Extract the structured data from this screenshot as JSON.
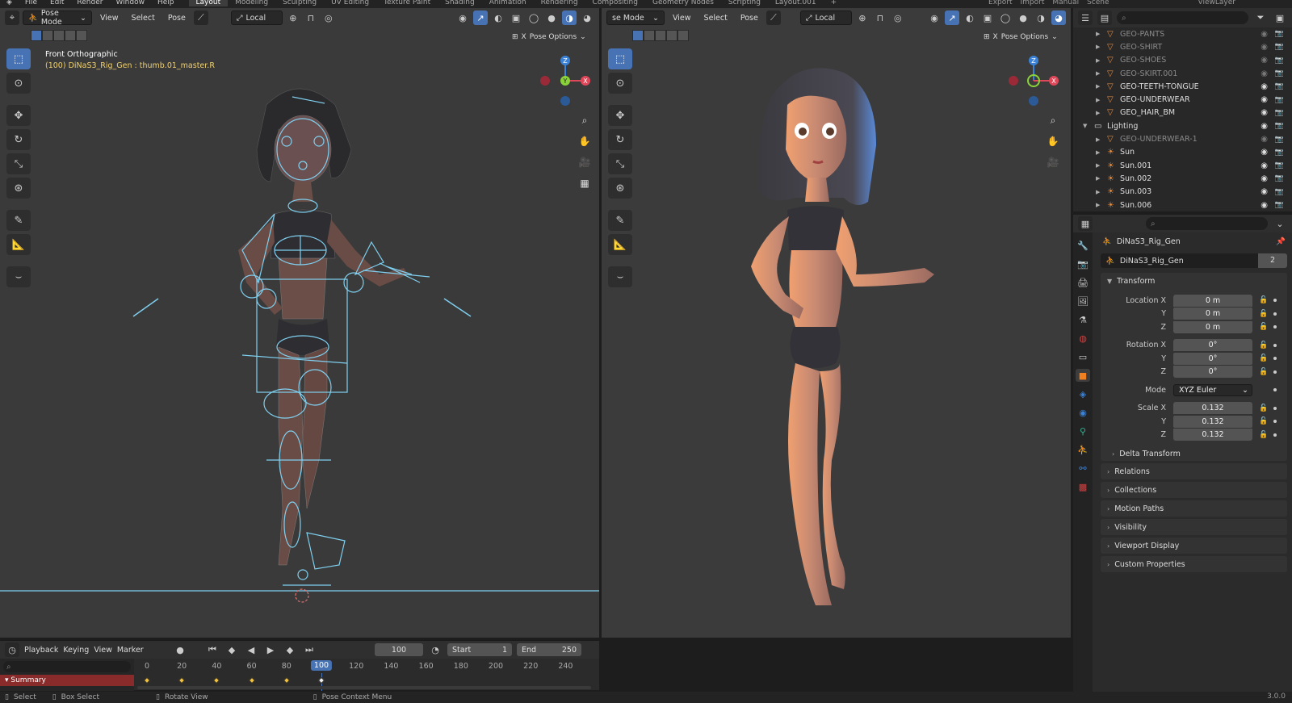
{
  "topbar": {
    "menu": [
      "File",
      "Edit",
      "Render",
      "Window",
      "Help"
    ],
    "workspaces": [
      "Layout",
      "Modeling",
      "Sculpting",
      "UV Editing",
      "Texture Paint",
      "Shading",
      "Animation",
      "Rendering",
      "Compositing",
      "Geometry Nodes",
      "Scripting",
      "Layout.001"
    ],
    "active_workspace": "Layout",
    "add_tab": "+",
    "export_label": "Export",
    "import_label": "Import",
    "manual_label": "Manual",
    "scene_label": "Scene",
    "viewlayer_label": "ViewLayer"
  },
  "viewport_left": {
    "mode": "Pose Mode",
    "menus": [
      "View",
      "Select",
      "Pose"
    ],
    "orientation": "Local",
    "pose_options": "Pose Options",
    "view_name": "Front Orthographic",
    "active_info": "(100) DiNaS3_Rig_Gen : thumb.01_master.R"
  },
  "viewport_right": {
    "mode": "se Mode",
    "menus": [
      "View",
      "Select",
      "Pose"
    ],
    "orientation": "Local",
    "pose_options": "Pose Options"
  },
  "gizmo_axes": {
    "x": "X",
    "y": "Y",
    "z": "Z"
  },
  "timeline": {
    "menus": [
      "Playback",
      "Keying",
      "View",
      "Marker"
    ],
    "current_frame": "100",
    "start_label": "Start",
    "start": "1",
    "end_label": "End",
    "end": "250",
    "ticks": [
      "0",
      "20",
      "40",
      "60",
      "80",
      "100",
      "120",
      "140",
      "160",
      "180",
      "200",
      "220",
      "240"
    ],
    "summary": "Summary",
    "keyframes": [
      0,
      20,
      40,
      60,
      80,
      100
    ]
  },
  "statusbar": {
    "select": "Select",
    "box_select": "Box Select",
    "rotate_view": "Rotate View",
    "context_menu": "Pose Context Menu",
    "version": "3.0.0"
  },
  "outliner": {
    "rows": [
      {
        "name": "GEO-PANTS",
        "indent": 1,
        "dim": true,
        "icon": "mesh"
      },
      {
        "name": "GEO-SHIRT",
        "indent": 1,
        "dim": true,
        "icon": "mesh"
      },
      {
        "name": "GEO-SHOES",
        "indent": 1,
        "dim": true,
        "icon": "mesh"
      },
      {
        "name": "GEO-SKIRT.001",
        "indent": 1,
        "dim": true,
        "icon": "mesh"
      },
      {
        "name": "GEO-TEETH-TONGUE",
        "indent": 1,
        "dim": false,
        "icon": "mesh"
      },
      {
        "name": "GEO-UNDERWEAR",
        "indent": 1,
        "dim": false,
        "icon": "mesh"
      },
      {
        "name": "GEO_HAIR_BM",
        "indent": 1,
        "dim": false,
        "icon": "mesh"
      },
      {
        "name": "Lighting",
        "indent": 0,
        "dim": false,
        "icon": "collection"
      },
      {
        "name": "GEO-UNDERWEAR-1",
        "indent": 1,
        "dim": true,
        "icon": "mesh"
      },
      {
        "name": "Sun",
        "indent": 1,
        "dim": false,
        "icon": "light"
      },
      {
        "name": "Sun.001",
        "indent": 1,
        "dim": false,
        "icon": "light"
      },
      {
        "name": "Sun.002",
        "indent": 1,
        "dim": false,
        "icon": "light"
      },
      {
        "name": "Sun.003",
        "indent": 1,
        "dim": false,
        "icon": "light"
      },
      {
        "name": "Sun.006",
        "indent": 1,
        "dim": false,
        "icon": "light"
      }
    ]
  },
  "properties": {
    "breadcrumb": "DiNaS3_Rig_Gen",
    "object_name": "DiNaS3_Rig_Gen",
    "users": "2",
    "transform_label": "Transform",
    "location_label": "Location X",
    "rotation_label": "Rotation X",
    "mode_label": "Mode",
    "scale_label": "Scale X",
    "y_label": "Y",
    "z_label": "Z",
    "location": [
      "0 m",
      "0 m",
      "0 m"
    ],
    "rotation": [
      "0°",
      "0°",
      "0°"
    ],
    "rotation_mode": "XYZ Euler",
    "scale": [
      "0.132",
      "0.132",
      "0.132"
    ],
    "delta_transform": "Delta Transform",
    "panels": [
      "Relations",
      "Collections",
      "Motion Paths",
      "Visibility",
      "Viewport Display",
      "Custom Properties"
    ]
  },
  "colors": {
    "accent": "#4772b3",
    "bone_wire": "#7fd0f0",
    "keyframe": "#f0c040",
    "summary": "#8a2b2b",
    "axis_x": "#e0485a",
    "axis_y": "#8ad23a",
    "axis_z": "#3b82d6"
  }
}
